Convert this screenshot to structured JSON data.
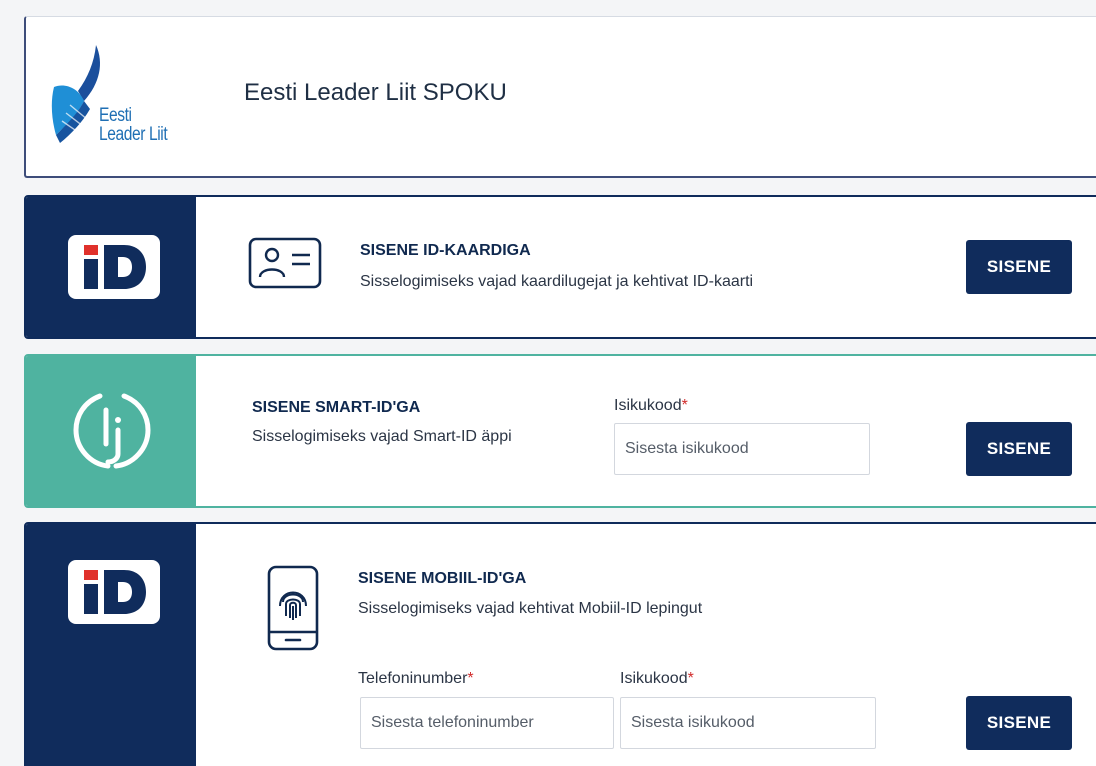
{
  "header": {
    "logo_line1": "Eesti",
    "logo_line2": "Leader Liit",
    "title": "Eesti Leader Liit SPOKU"
  },
  "id_card": {
    "badge_icon": "id-logo-icon",
    "method_icon": "id-card-icon",
    "title": "SISENE ID-KAARDIGA",
    "description": "Sisselogimiseks vajad kaardilugejat ja kehtivat ID-kaarti",
    "button": "SISENE"
  },
  "smart_id": {
    "badge_icon": "smart-id-logo-icon",
    "title": "SISENE SMART-ID'GA",
    "description": "Sisselogimiseks vajad Smart-ID äppi",
    "personal_code_label": "Isikukood",
    "required_mark": "*",
    "personal_code_placeholder": "Sisesta isikukood",
    "personal_code_value": "",
    "button": "SISENE"
  },
  "mobile_id": {
    "badge_icon": "id-logo-icon",
    "method_icon": "phone-fingerprint-icon",
    "title": "SISENE MOBIIL-ID'GA",
    "description": "Sisselogimiseks vajad kehtivat Mobiil-ID lepingut",
    "phone_label": "Telefoninumber",
    "personal_code_label": "Isikukood",
    "required_mark": "*",
    "phone_placeholder": "Sisesta telefoninumber",
    "phone_value": "",
    "personal_code_placeholder": "Sisesta isikukood",
    "personal_code_value": "",
    "button": "SISENE"
  },
  "colors": {
    "navy": "#102c5c",
    "teal": "#4fb3a0",
    "red_accent": "#e0312b",
    "logo_blue": "#1f6fb4"
  }
}
